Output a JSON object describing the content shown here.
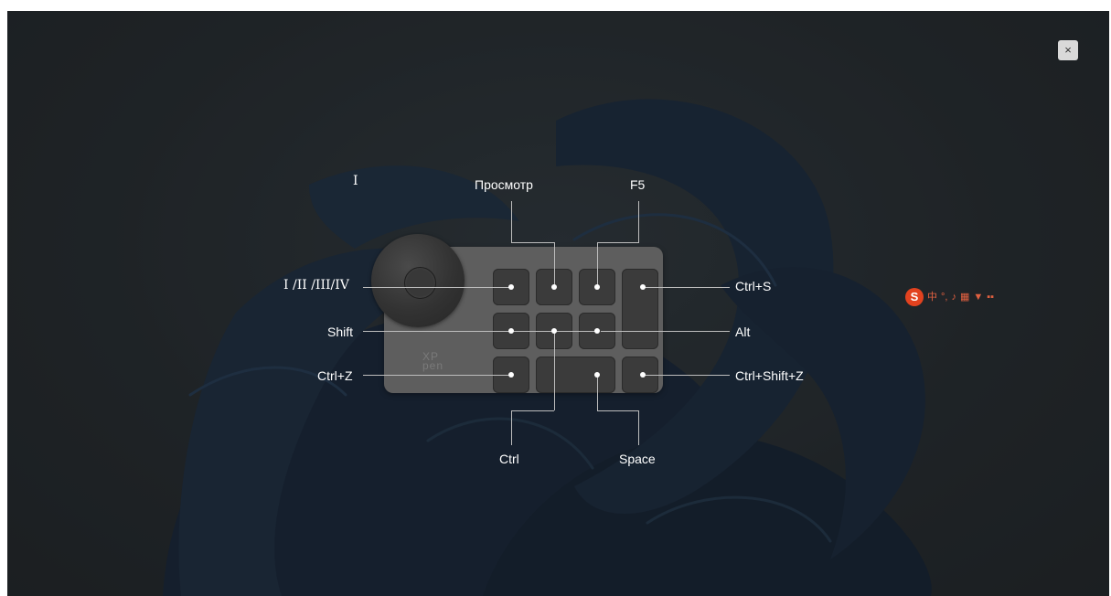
{
  "overlay": {
    "close_label": "×"
  },
  "device": {
    "brand_logo": "XP-pen"
  },
  "labels": {
    "dial_top": "I",
    "dial_left": "I /II /III/IV",
    "key_top_1": "Просмотр",
    "key_top_2": "F5",
    "row1_right": "Ctrl+S",
    "row2_left": "Shift",
    "row2_right": "Alt",
    "row3_left": "Ctrl+Z",
    "row3_right": "Ctrl+Shift+Z",
    "bottom_1": "Ctrl",
    "bottom_2": "Space"
  },
  "taskbar_ime": {
    "icons": [
      "sogou-s-icon",
      "chinese-mode-icon",
      "punctuation-icon",
      "microphone-icon",
      "keyboard-icon",
      "skin-icon",
      "grid-icon"
    ],
    "chinese_char": "中"
  }
}
